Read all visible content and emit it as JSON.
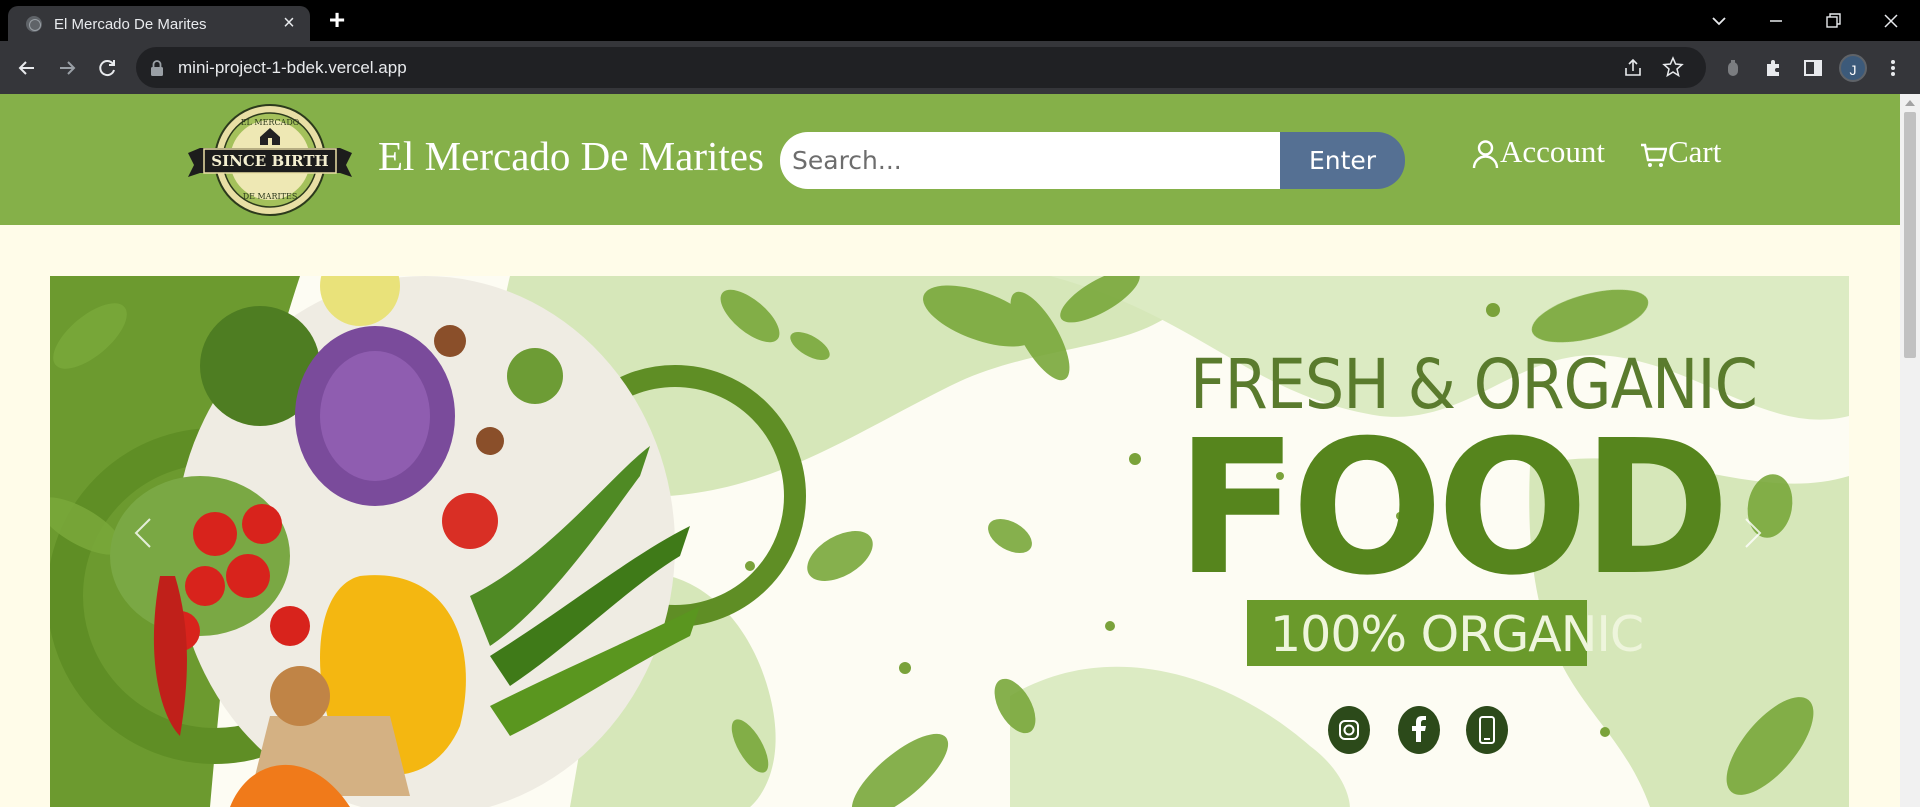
{
  "browser": {
    "tab_title": "El Mercado De Marites",
    "url": "mini-project-1-bdek.vercel.app",
    "profile_initial": "J"
  },
  "header": {
    "site_title": "El Mercado De Marites",
    "logo_text_top": "EL MERCADO",
    "logo_text_band": "SINCE BIRTH",
    "logo_text_bottom": "DE MARITES",
    "search": {
      "placeholder": "Search...",
      "value": ""
    },
    "search_button": "Enter",
    "account_label": "Account",
    "cart_label": "Cart"
  },
  "hero": {
    "line1": "FRESH & ORGANIC",
    "line2": "FOOD",
    "line3": "100% ORGANIC",
    "social_icons": [
      "instagram-icon",
      "facebook-icon",
      "phone-icon"
    ]
  },
  "colors": {
    "navbar": "#85b049",
    "page_bg": "#fffce9",
    "search_button": "#557093",
    "hero_green": "#56851d"
  }
}
